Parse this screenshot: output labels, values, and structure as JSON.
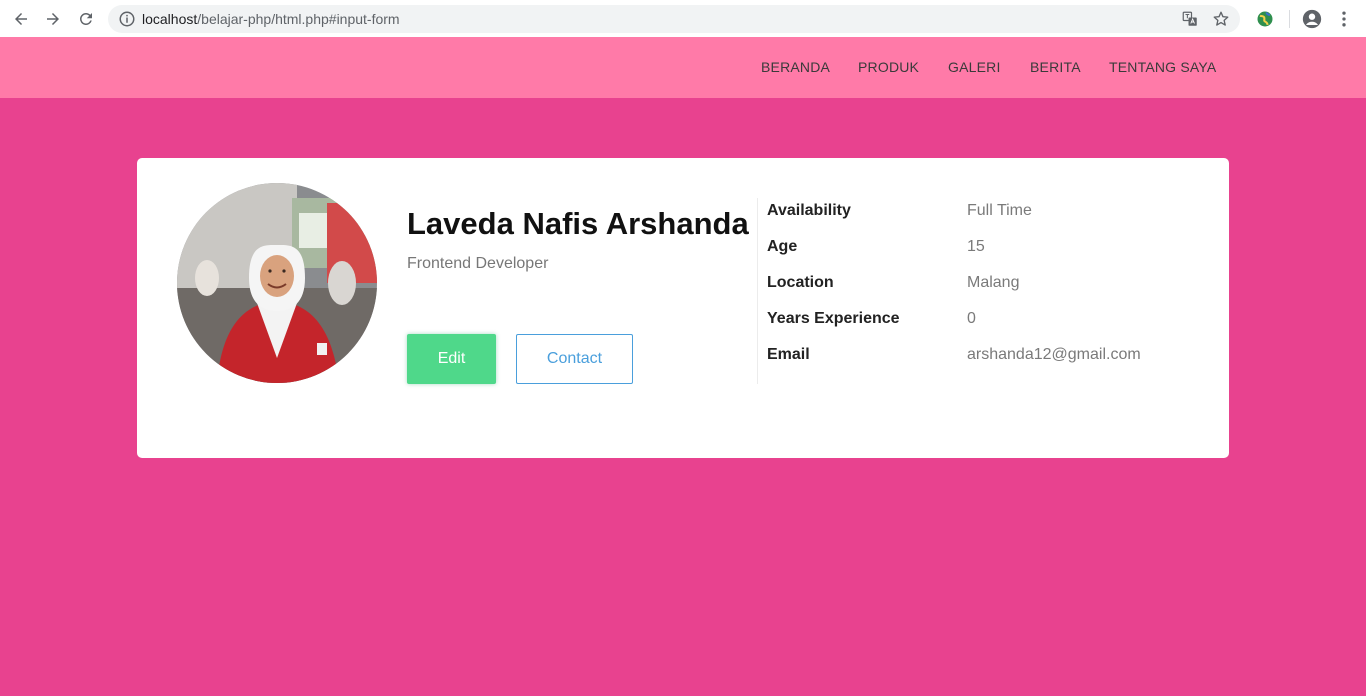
{
  "browser": {
    "url_host": "localhost",
    "url_path": "/belajar-php/html.php#input-form"
  },
  "nav": {
    "items": [
      "BERANDA",
      "PRODUK",
      "GALERI",
      "BERITA",
      "TENTANG SAYA"
    ]
  },
  "profile": {
    "name": "Laveda Nafis Arshanda",
    "role": "Frontend Developer",
    "edit_label": "Edit",
    "contact_label": "Contact",
    "details": [
      {
        "key": "Availability",
        "value": "Full Time"
      },
      {
        "key": "Age",
        "value": "15"
      },
      {
        "key": "Location",
        "value": "Malang"
      },
      {
        "key": "Years Experience",
        "value": "0"
      },
      {
        "key": "Email",
        "value": "arshanda12@gmail.com"
      }
    ]
  },
  "colors": {
    "page_bg": "#e8428f",
    "navbar_bg": "#ff7aa8",
    "edit_button": "#4fd88a",
    "contact_border": "#4a9fdc"
  }
}
